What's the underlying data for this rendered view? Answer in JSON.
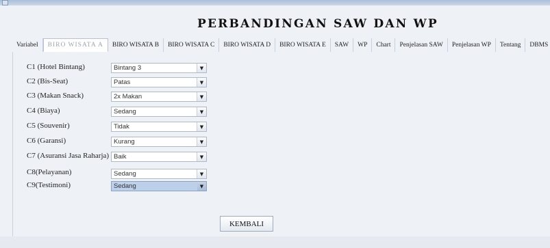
{
  "window": {
    "title": ""
  },
  "header": {
    "title": "PERBANDINGAN SAW DAN WP"
  },
  "tabs": [
    {
      "label": "Variabel"
    },
    {
      "label": "BIRO WISATA A"
    },
    {
      "label": "BIRO WISATA B"
    },
    {
      "label": "BIRO WISATA C"
    },
    {
      "label": "BIRO WISATA D"
    },
    {
      "label": "BIRO WISATA E"
    },
    {
      "label": "SAW"
    },
    {
      "label": "WP"
    },
    {
      "label": "Chart"
    },
    {
      "label": "Penjelasan SAW"
    },
    {
      "label": "Penjelasan WP"
    },
    {
      "label": "Tentang"
    },
    {
      "label": "DBMS"
    }
  ],
  "form": {
    "rows": [
      {
        "label": "C1 (Hotel Bintang)",
        "value": "Bintang 3"
      },
      {
        "label": "C2 (Bis-Seat)",
        "value": "Patas"
      },
      {
        "label": "C3 (Makan Snack)",
        "value": "2x Makan"
      },
      {
        "label": "C4 (Biaya)",
        "value": "Sedang"
      },
      {
        "label": "C5 (Souvenir)",
        "value": "Tidak"
      },
      {
        "label": "C6 (Garansi)",
        "value": "Kurang"
      },
      {
        "label": "C7 (Asuransi Jasa Raharja)",
        "value": "Baik"
      },
      {
        "label": "C8(Pelayanan)",
        "value": "Sedang"
      },
      {
        "label": "C9(Testimoni)",
        "value": "Sedang"
      }
    ]
  },
  "buttons": {
    "back_label": "KEMBALI"
  },
  "icons": {
    "combo_arrow": "chevron-down-icon",
    "app": "app-window-icon"
  }
}
